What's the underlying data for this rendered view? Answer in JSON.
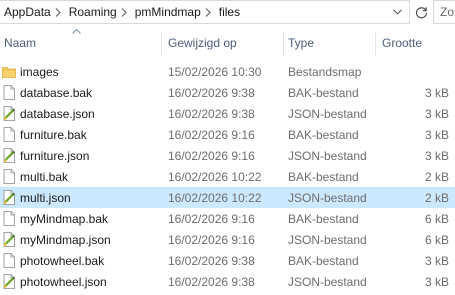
{
  "breadcrumb": [
    "AppData",
    "Roaming",
    "pmMindmap",
    "files"
  ],
  "search": {
    "text": "Zo"
  },
  "columns": {
    "name": "Naam",
    "modified": "Gewijzigd op",
    "type": "Type",
    "size": "Grootte"
  },
  "files": [
    {
      "name": "images",
      "modified": "15/02/2026 10:30",
      "type": "Bestandsmap",
      "size": "",
      "icon": "folder-icon"
    },
    {
      "name": "database.bak",
      "modified": "16/02/2026 9:38",
      "type": "BAK-bestand",
      "size": "3 kB",
      "icon": "file-icon"
    },
    {
      "name": "database.json",
      "modified": "16/02/2026 9:38",
      "type": "JSON-bestand",
      "size": "3 kB",
      "icon": "json-file-icon"
    },
    {
      "name": "furniture.bak",
      "modified": "16/02/2026 9:16",
      "type": "BAK-bestand",
      "size": "3 kB",
      "icon": "file-icon"
    },
    {
      "name": "furniture.json",
      "modified": "16/02/2026 9:16",
      "type": "JSON-bestand",
      "size": "3 kB",
      "icon": "json-file-icon"
    },
    {
      "name": "multi.bak",
      "modified": "16/02/2026 10:22",
      "type": "BAK-bestand",
      "size": "2 kB",
      "icon": "file-icon"
    },
    {
      "name": "multi.json",
      "modified": "16/02/2026 10:22",
      "type": "JSON-bestand",
      "size": "2 kB",
      "icon": "json-file-icon",
      "selected": true
    },
    {
      "name": "myMindmap.bak",
      "modified": "16/02/2026 9:16",
      "type": "BAK-bestand",
      "size": "6 kB",
      "icon": "file-icon"
    },
    {
      "name": "myMindmap.json",
      "modified": "16/02/2026 9:16",
      "type": "JSON-bestand",
      "size": "6 kB",
      "icon": "json-file-icon"
    },
    {
      "name": "photowheel.bak",
      "modified": "16/02/2026 9:38",
      "type": "BAK-bestand",
      "size": "3 kB",
      "icon": "file-icon"
    },
    {
      "name": "photowheel.json",
      "modified": "16/02/2026 9:38",
      "type": "JSON-bestand",
      "size": "3 kB",
      "icon": "json-file-icon"
    }
  ]
}
